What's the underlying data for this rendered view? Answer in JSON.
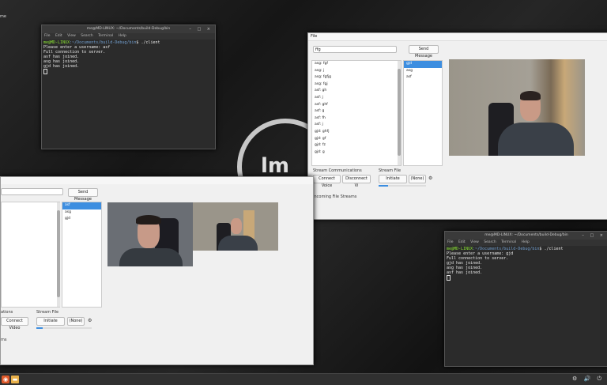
{
  "desktop": {
    "corner_text": "me"
  },
  "terminal1": {
    "title": "me@MD-LINUX: ~/Documents/build-Debug/bin",
    "menu": [
      "File",
      "Edit",
      "View",
      "Search",
      "Terminal",
      "Help"
    ],
    "prompt_user": "me@MD-LINUX",
    "prompt_path": ":~/Documents/build-Debug/bin",
    "command": "$ ./client",
    "lines": [
      "Please enter a username: asf",
      "Full connection to server.",
      "asf has joined.",
      "asg has joined.",
      "gjd has joined."
    ]
  },
  "terminal2": {
    "title": "me@MD-LINUX: ~/Documents/build-Debug/bin",
    "menu": [
      "File",
      "Edit",
      "View",
      "Search",
      "Terminal",
      "Help"
    ],
    "prompt_user": "me@MD-LINUX",
    "prompt_path": ":~/Documents/build-Debug/bin",
    "command": "$ ./client",
    "lines": [
      "Please enter a username: gjd",
      "Full connection to server.",
      "gjd has joined.",
      "asg has joined.",
      "asf has joined."
    ]
  },
  "app_right": {
    "menu": "File",
    "input_value": "ffg",
    "send_label": "Send Message",
    "messages": [
      "asg: fgf",
      "asg: j",
      "asg: fgfjg",
      "asg: fgj",
      "asf: gh",
      "asf: j",
      "asf: ghf",
      "asf: g",
      "asf: fh",
      "asf: j",
      "gjd: ghfj",
      "gjd: gf",
      "gjd: fz",
      "gjd: g"
    ],
    "users": [
      "gjd",
      "asg",
      "asf"
    ],
    "stream_comm_label": "Stream Communications",
    "connect_voice": "Connect Voice",
    "disconnect_video": "Disconnect Vi",
    "stream_file_label": "Stream File",
    "initiate": "Initiate",
    "file_choice": "(None)",
    "incoming_label": "Incoming File Streams"
  },
  "app_left": {
    "send_label": "Send Message",
    "users": [
      "asf",
      "asg",
      "gjd"
    ],
    "stream_comm_label": "ations",
    "connect_video": "Connect Video",
    "stream_file_label": "Stream File",
    "initiate": "Initiate",
    "file_choice": "(None)",
    "incoming_label": "ms"
  },
  "icons": {
    "term_controls": "minimize-maximize-close-icons",
    "folder": "folder-icon",
    "menu": "mint-menu-icon"
  },
  "taskbar": {
    "tray": "⚙ 🔊 ⏻"
  }
}
